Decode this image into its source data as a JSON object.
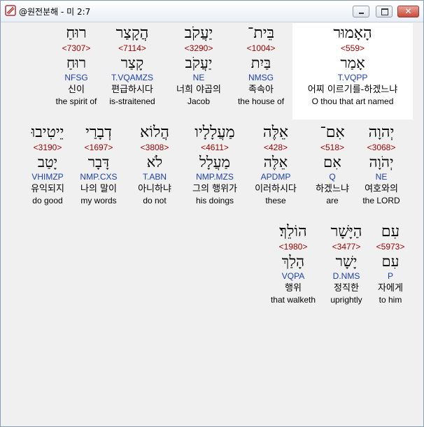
{
  "window": {
    "title": "@원전분해 - 미 2:7"
  },
  "rows": [
    [
      {
        "heb": "הָאָמוּר",
        "strong": "<559>",
        "lemma": "אָמַר",
        "gram": "T.VQPP",
        "kor": "어찌 이르기를-하겠느냐",
        "eng": "O thou that art named",
        "highlight": true
      },
      {
        "heb": "בֵּית־",
        "strong": "<1004>",
        "lemma": "בַּיִת",
        "gram": "NMSG",
        "kor": "족속아",
        "eng": "the house of"
      },
      {
        "heb": "יַעֲקֹב",
        "strong": "<3290>",
        "lemma": "יַעֲקֹב",
        "gram": "NE",
        "kor": "너희 야곱의",
        "eng": "Jacob"
      },
      {
        "heb": "הֲקָצַר",
        "strong": "<7114>",
        "lemma": "קָצַר",
        "gram": "T.VQAMZS",
        "kor": "편급하시다",
        "eng": "is-straitened"
      },
      {
        "heb": "רוּחַ",
        "strong": "<7307>",
        "lemma": "רוּחַ",
        "gram": "NFSG",
        "kor": "신이",
        "eng": "the spirit of"
      }
    ],
    [
      {
        "heb": "יְהוָה",
        "strong": "<3068>",
        "lemma": "יְהֹוָה",
        "gram": "NE",
        "kor": "여호와의",
        "eng": "the LORD"
      },
      {
        "heb": "אִם־",
        "strong": "<518>",
        "lemma": "אִם",
        "gram": "Q",
        "kor": "하겠느냐",
        "eng": "are"
      },
      {
        "heb": "אֵלֶּה",
        "strong": "<428>",
        "lemma": "אֵלֶּה",
        "gram": "APDMP",
        "kor": "이러하시다",
        "eng": "these"
      },
      {
        "heb": "מַעֲלָלָיו",
        "strong": "<4611>",
        "lemma": "מַעֲלָל",
        "gram": "NMP.MZS",
        "kor": "그의 행위가",
        "eng": "his doings"
      },
      {
        "heb": "הֲלוֹא",
        "strong": "<3808>",
        "lemma": "לֹא",
        "gram": "T.ABN",
        "kor": "아니하냐",
        "eng": "do not"
      },
      {
        "heb": "דְבָרַי",
        "strong": "<1697>",
        "lemma": "דָּבָר",
        "gram": "NMP.CXS",
        "kor": "나의 말이",
        "eng": "my words"
      },
      {
        "heb": "יֵיטִיבוּ",
        "strong": "<3190>",
        "lemma": "יָטַב",
        "gram": "VHIMZP",
        "kor": "유익되지",
        "eng": "do good"
      }
    ],
    [
      {
        "heb": "עִם",
        "strong": "<5973>",
        "lemma": "עִם",
        "gram": "P",
        "kor": "자에게",
        "eng": "to him"
      },
      {
        "heb": "הַיָּשָׁר",
        "strong": "<3477>",
        "lemma": "יָשָׁר",
        "gram": "D.NMS",
        "kor": "정직한",
        "eng": "uprightly"
      },
      {
        "heb": "הוֹלֵךְ׃",
        "strong": "<1980>",
        "lemma": "הָלַךְ",
        "gram": "VQPA",
        "kor": "행위",
        "eng": "that walketh"
      }
    ]
  ]
}
